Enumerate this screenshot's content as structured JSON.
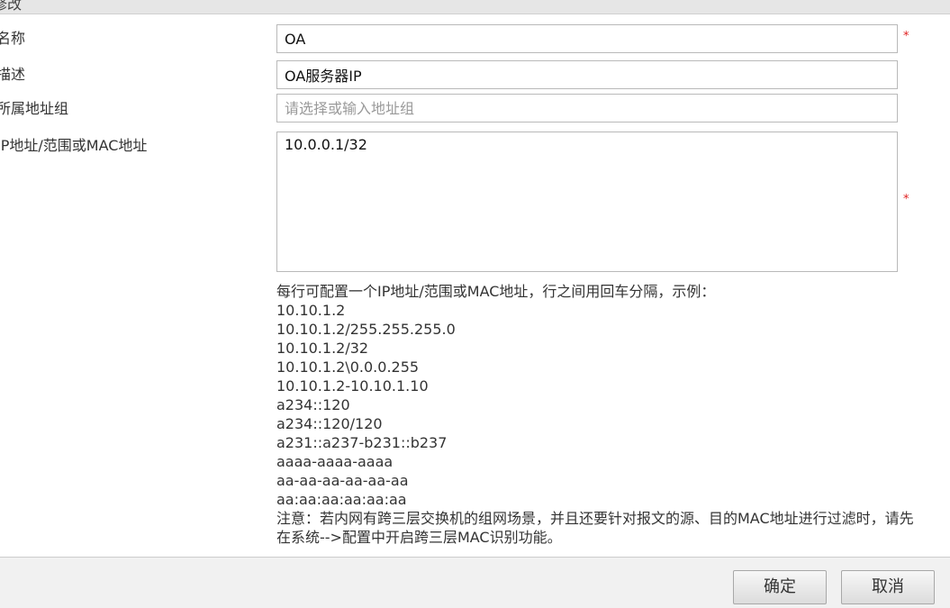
{
  "dialog": {
    "title_fragment": "修改"
  },
  "form": {
    "name_label": "名称",
    "name_value": "OA",
    "desc_label": "描述",
    "desc_value": "OA服务器IP",
    "group_label": "所属地址组",
    "group_placeholder": "请选择或输入地址组",
    "ip_label": "IP地址/范围或MAC地址",
    "ip_value": "10.0.0.1/32",
    "required_mark": "*"
  },
  "help": {
    "intro": "每行可配置一个IP地址/范围或MAC地址，行之间用回车分隔，示例：",
    "examples": [
      "10.10.1.2",
      "10.10.1.2/255.255.255.0",
      "10.10.1.2/32",
      "10.10.1.2\\0.0.0.255",
      "10.10.1.2-10.10.1.10",
      "a234::120",
      "a234::120/120",
      "a231::a237-b231::b237",
      "aaaa-aaaa-aaaa",
      "aa-aa-aa-aa-aa-aa",
      "aa:aa:aa:aa:aa:aa"
    ],
    "note": "注意：若内网有跨三层交换机的组网场景，并且还要针对报文的源、目的MAC地址进行过滤时，请先在系统-->配置中开启跨三层MAC识别功能。"
  },
  "buttons": {
    "ok": "确定",
    "cancel": "取消"
  },
  "colors": {
    "required": "#e02020",
    "border": "#b9b9b9",
    "footer_bg": "#f1f1f1"
  }
}
